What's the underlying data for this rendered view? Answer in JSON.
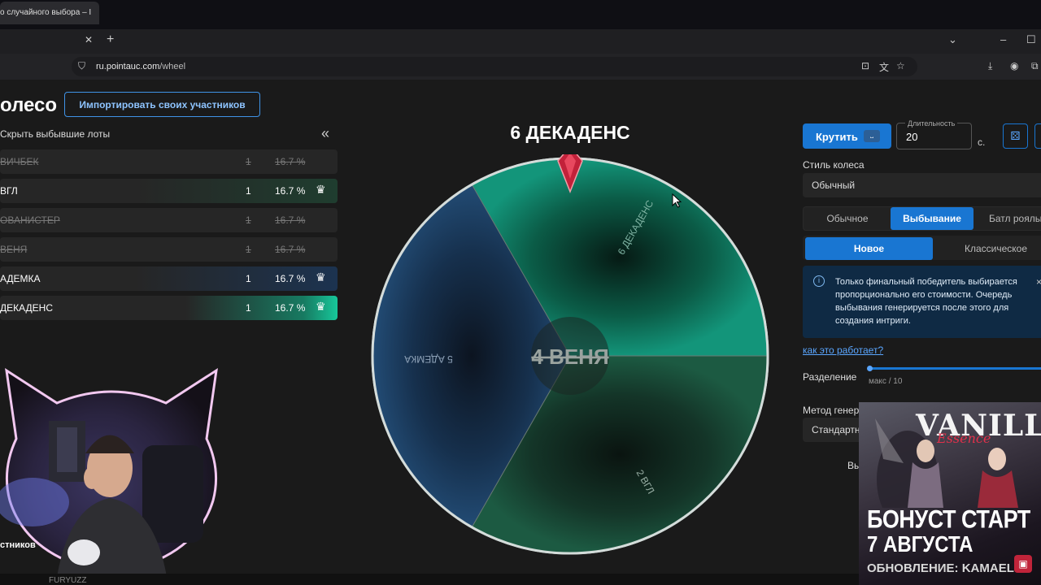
{
  "browser": {
    "tab_title": "о случайного выбора – I",
    "url_domain": "ru.pointauc.com",
    "url_path": "/wheel",
    "tab_close": "✕",
    "new_tab": "+"
  },
  "left": {
    "title": "олесо",
    "import_button": "Импортировать своих участников",
    "hide_lots": "Скрыть выбывшие лоты",
    "collapse_icon": "«",
    "lots": [
      {
        "name": "ВИЧБЕК",
        "qty": "1",
        "pct": "16.7 %",
        "state": "out"
      },
      {
        "name": "ВГЛ",
        "qty": "1",
        "pct": "16.7 %",
        "state": "active",
        "color": "#1f3d2f"
      },
      {
        "name": "ОВАНИСТЕР",
        "qty": "1",
        "pct": "16.7 %",
        "state": "out"
      },
      {
        "name": "ВЕНЯ",
        "qty": "1",
        "pct": "16.7 %",
        "state": "out"
      },
      {
        "name": "АДЕМКА",
        "qty": "1",
        "pct": "16.7 %",
        "state": "active",
        "color": "#1c3350"
      },
      {
        "name": "ДЕКАДЕНС",
        "qty": "1",
        "pct": "16.7 %",
        "state": "active",
        "color": "#177a61"
      }
    ],
    "participants_label": "стников"
  },
  "wheel": {
    "winner": "6 ДЕКАДЕНС",
    "center_text": "4 ВЕНЯ",
    "segments": [
      {
        "label": "6 ДЕКАДЕНС",
        "color": "#0f8a6c"
      },
      {
        "label": "2 ВГЛ",
        "color": "#0d4a37"
      },
      {
        "label": "5 АДЕМКА",
        "color": "#1c3a5c"
      }
    ]
  },
  "right": {
    "spin_button": "Крутить",
    "spin_key": "⎵",
    "duration_label": "Длительность",
    "duration_value": "20",
    "duration_unit": "с.",
    "style_label": "Стиль колеса",
    "style_value": "Обычный",
    "modes": [
      "Обычное",
      "Выбывание",
      "Батл роялы"
    ],
    "active_mode": "Выбывание",
    "submodes": [
      "Новое",
      "Классическое"
    ],
    "active_submode": "Новое",
    "info_text": "Только финальный победитель выбирается пропорционально его стоимости. Очередь выбывания генерируется после этого для создания интриги.",
    "info_close": "×",
    "how_link": "как это работает?",
    "split_label": "Разделение",
    "split_hint": "макс / 10",
    "method_label": "Метод генер",
    "method_value": "Стандартн",
    "trunc_text": "Вы"
  },
  "ad": {
    "logo": "VANILLA",
    "logo_sub": "Essence",
    "line1": "БОНУСТ СТАРТ",
    "line2": "7 АВГУСТА",
    "line3": "ОБНОВЛЕНИЕ: KAMAEL"
  },
  "bottom": {
    "text": "FURYUZZ"
  },
  "colors": {
    "accent": "#1976d2",
    "link": "#5aa6ff",
    "bg": "#1a1a1a"
  }
}
